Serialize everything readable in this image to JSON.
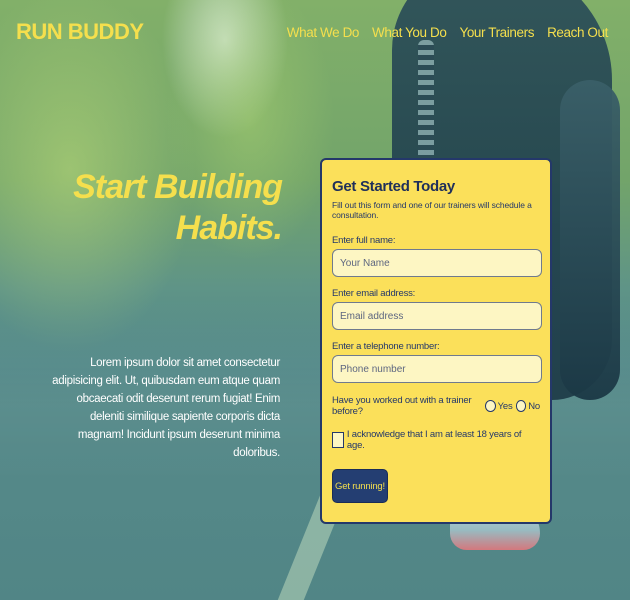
{
  "header": {
    "logo": "RUN BUDDY",
    "nav": [
      "What We Do",
      "What You Do",
      "Your Trainers",
      "Reach Out"
    ]
  },
  "hero": {
    "title_line1": "Start Building",
    "title_line2": "Habits.",
    "copy": "Lorem ipsum dolor sit amet consectetur adipisicing elit. Ut, quibusdam eum atque quam obcaecati odit deserunt rerum fugiat! Enim deleniti similique sapiente corporis dicta magnam! Incidunt ipsum deserunt minima doloribus."
  },
  "form": {
    "title": "Get Started Today",
    "subtitle": "Fill out this form and one of our trainers will schedule a consultation.",
    "name_label": "Enter full name:",
    "name_placeholder": "Your Name",
    "email_label": "Enter email address:",
    "email_placeholder": "Email address",
    "phone_label": "Enter a telephone number:",
    "phone_placeholder": "Phone number",
    "trainer_question": "Have you worked out with a trainer before?",
    "yes_label": "Yes",
    "no_label": "No",
    "age_ack": "I acknowledge that I am at least 18 years of age.",
    "submit_label": "Get running!"
  },
  "colors": {
    "accent": "#f5df4d",
    "form_bg": "#fbe05a",
    "navy": "#24386a"
  }
}
